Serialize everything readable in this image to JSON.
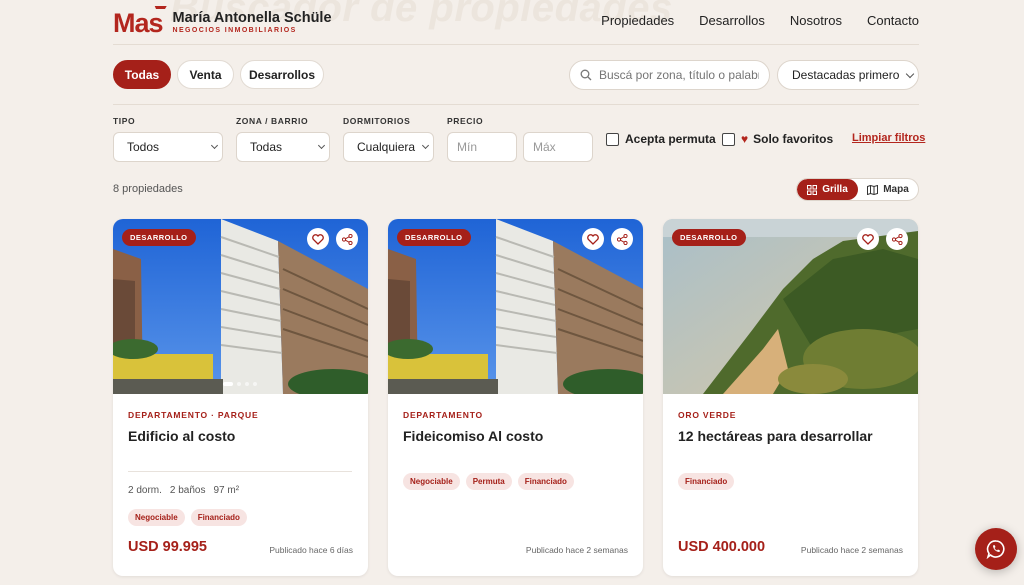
{
  "header": {
    "watermark": "Buscador de propiedades",
    "logo_mark": "Mas",
    "logo_name": "María Antonella Schüle",
    "logo_sub": "NEGOCIOS INMOBILIARIOS",
    "nav": [
      "Propiedades",
      "Desarrollos",
      "Nosotros",
      "Contacto"
    ]
  },
  "tabs": [
    "Todas",
    "Venta",
    "Desarrollos"
  ],
  "search": {
    "placeholder": "Buscá por zona, título o palabra clave"
  },
  "sort": {
    "value": "Destacadas primero"
  },
  "filters": {
    "tipo": {
      "label": "TIPO",
      "value": "Todos"
    },
    "zona": {
      "label": "ZONA / BARRIO",
      "value": "Todas"
    },
    "dormitorios": {
      "label": "DORMITORIOS",
      "value": "Cualquiera"
    },
    "precio": {
      "label": "PRECIO",
      "min_placeholder": "Mín",
      "max_placeholder": "Máx"
    },
    "permuta": "Acepta permuta",
    "favoritos": "Solo favoritos",
    "clear": "Limpiar filtros"
  },
  "results": {
    "count": "8 propiedades",
    "view_grid": "Grilla",
    "view_map": "Mapa"
  },
  "cards": [
    {
      "badge": "DESARROLLO",
      "kicker": "DEPARTAMENTO · PARQUE",
      "title": "Edificio al costo",
      "specs": [
        "2 dorm.",
        "2 baños",
        "97 m²"
      ],
      "tags": [
        "Negociable",
        "Financiado"
      ],
      "price": "USD 99.995",
      "published": "Publicado hace 6 días"
    },
    {
      "badge": "DESARROLLO",
      "kicker": "DEPARTAMENTO",
      "title": "Fideicomiso Al costo",
      "tags": [
        "Negociable",
        "Permuta",
        "Financiado"
      ],
      "published": "Publicado hace 2 semanas"
    },
    {
      "badge": "DESARROLLO",
      "kicker": "ORO VERDE",
      "title": "12 hectáreas para desarrollar",
      "tags": [
        "Financiado"
      ],
      "price": "USD 400.000",
      "published": "Publicado hace 2 semanas"
    }
  ],
  "colors": {
    "accent": "#a52019",
    "background": "#f4efea"
  }
}
